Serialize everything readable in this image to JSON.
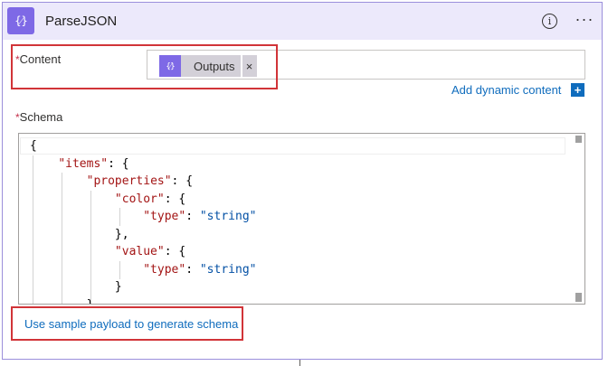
{
  "action": {
    "icon": "curly-braces-icon",
    "icon_glyph": "{⁄}",
    "title": "ParseJSON",
    "info_icon": "info-icon",
    "info_glyph": "i",
    "more_icon": "more-options-icon",
    "more_glyph": "···"
  },
  "content_field": {
    "required_mark": "*",
    "label": "Content",
    "token": {
      "icon": "curly-braces-icon",
      "icon_glyph": "{⁄}",
      "label": "Outputs",
      "close_glyph": "×"
    }
  },
  "dynamic_content": {
    "label": "Add dynamic content",
    "plus_glyph": "+"
  },
  "schema_field": {
    "required_mark": "*",
    "label": "Schema",
    "code_lines": [
      [
        {
          "t": "{",
          "c": "p"
        }
      ],
      [
        {
          "t": "    ",
          "c": "p"
        },
        {
          "t": "\"items\"",
          "c": "k"
        },
        {
          "t": ": {",
          "c": "p"
        }
      ],
      [
        {
          "t": "        ",
          "c": "p"
        },
        {
          "t": "\"properties\"",
          "c": "k"
        },
        {
          "t": ": {",
          "c": "p"
        }
      ],
      [
        {
          "t": "            ",
          "c": "p"
        },
        {
          "t": "\"color\"",
          "c": "k"
        },
        {
          "t": ": {",
          "c": "p"
        }
      ],
      [
        {
          "t": "                ",
          "c": "p"
        },
        {
          "t": "\"type\"",
          "c": "k"
        },
        {
          "t": ": ",
          "c": "p"
        },
        {
          "t": "\"string\"",
          "c": "s"
        }
      ],
      [
        {
          "t": "            },",
          "c": "p"
        }
      ],
      [
        {
          "t": "            ",
          "c": "p"
        },
        {
          "t": "\"value\"",
          "c": "k"
        },
        {
          "t": ": {",
          "c": "p"
        }
      ],
      [
        {
          "t": "                ",
          "c": "p"
        },
        {
          "t": "\"type\"",
          "c": "k"
        },
        {
          "t": ": ",
          "c": "p"
        },
        {
          "t": "\"string\"",
          "c": "s"
        }
      ],
      [
        {
          "t": "            }",
          "c": "p"
        }
      ],
      [
        {
          "t": "        }",
          "c": "p"
        }
      ]
    ]
  },
  "sample_payload_link": "Use sample payload to generate schema",
  "colors": {
    "accent": "#7e69e6",
    "header_bg": "#ece9fb",
    "link": "#0f6cbd",
    "highlight_box": "#d13438",
    "required": "#c4314b",
    "json_key": "#a31515",
    "json_string": "#0451a5"
  }
}
